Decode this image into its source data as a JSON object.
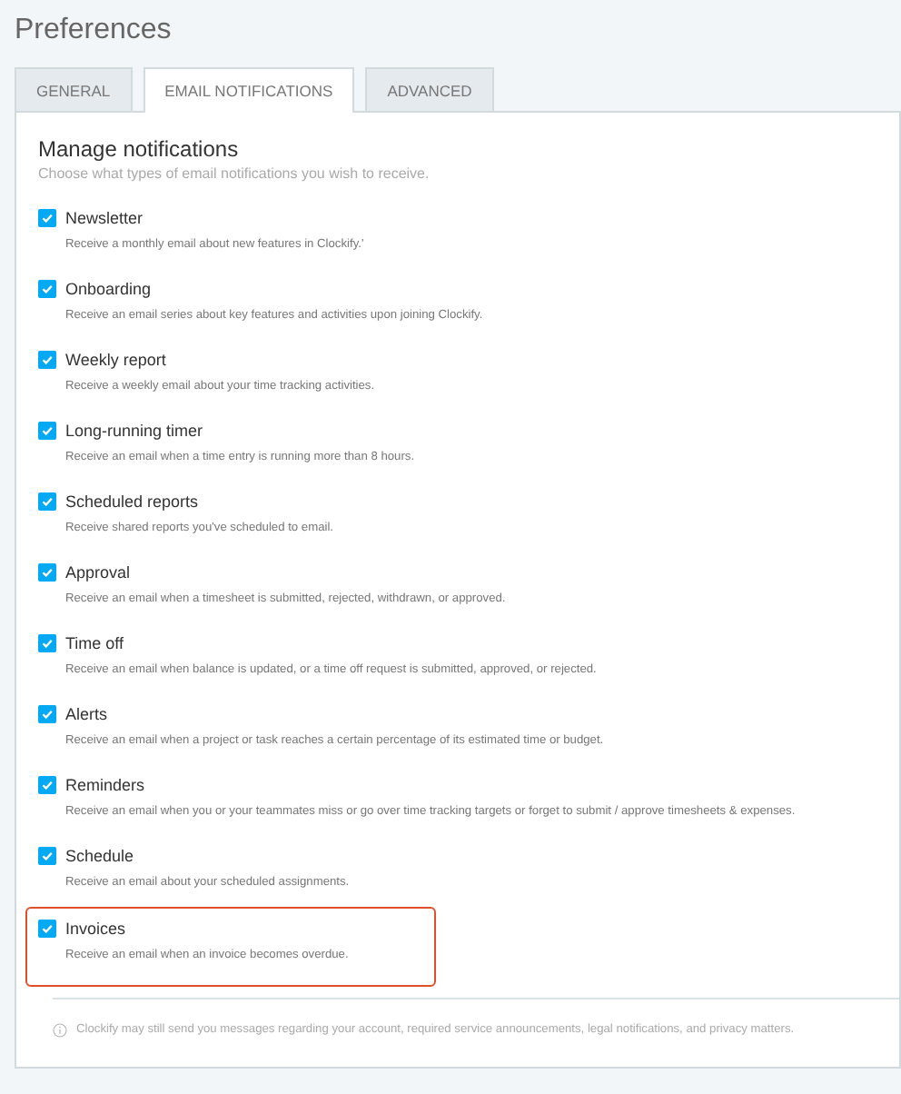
{
  "page": {
    "title": "Preferences"
  },
  "tabs": [
    {
      "label": "GENERAL",
      "selected": false
    },
    {
      "label": "EMAIL NOTIFICATIONS",
      "selected": true
    },
    {
      "label": "ADVANCED",
      "selected": false
    }
  ],
  "section": {
    "heading": "Manage notifications",
    "subtitle": "Choose what types of email notifications you wish to receive."
  },
  "notifications": [
    {
      "label": "Newsletter",
      "description": "Receive a monthly email about new features in Clockify.'",
      "checked": true,
      "highlighted": false
    },
    {
      "label": "Onboarding",
      "description": "Receive an email series about key features and activities upon joining Clockify.",
      "checked": true,
      "highlighted": false
    },
    {
      "label": "Weekly report",
      "description": "Receive a weekly email about your time tracking activities.",
      "checked": true,
      "highlighted": false
    },
    {
      "label": "Long-running timer",
      "description": "Receive an email when a time entry is running more than 8 hours.",
      "checked": true,
      "highlighted": false
    },
    {
      "label": "Scheduled reports",
      "description": "Receive shared reports you've scheduled to email.",
      "checked": true,
      "highlighted": false
    },
    {
      "label": "Approval",
      "description": "Receive an email when a timesheet is submitted, rejected, withdrawn, or approved.",
      "checked": true,
      "highlighted": false
    },
    {
      "label": "Time off",
      "description": "Receive an email when balance is updated, or a time off request is submitted, approved, or rejected.",
      "checked": true,
      "highlighted": false
    },
    {
      "label": "Alerts",
      "description": "Receive an email when a project or task reaches a certain percentage of its estimated time or budget.",
      "checked": true,
      "highlighted": false
    },
    {
      "label": "Reminders",
      "description": "Receive an email when you or your teammates miss or go over time tracking targets or forget to submit / approve timesheets & expenses.",
      "checked": true,
      "highlighted": false
    },
    {
      "label": "Schedule",
      "description": "Receive an email about your scheduled assignments.",
      "checked": true,
      "highlighted": false
    },
    {
      "label": "Invoices",
      "description": "Receive an email when an invoice becomes overdue.",
      "checked": true,
      "highlighted": true
    }
  ],
  "footer_note": "Clockify may still send you messages regarding your account, required service announcements, legal notifications, and privacy matters."
}
